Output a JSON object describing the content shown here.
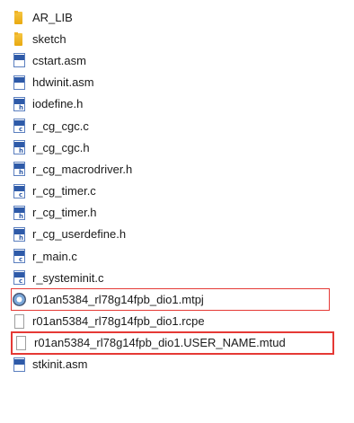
{
  "files": [
    {
      "name": "AR_LIB",
      "icon": "folder-icon"
    },
    {
      "name": "sketch",
      "icon": "folder-icon"
    },
    {
      "name": "cstart.asm",
      "icon": "asm-file-icon"
    },
    {
      "name": "hdwinit.asm",
      "icon": "asm-file-icon"
    },
    {
      "name": "iodefine.h",
      "icon": "header-file-icon"
    },
    {
      "name": "r_cg_cgc.c",
      "icon": "c-file-icon"
    },
    {
      "name": "r_cg_cgc.h",
      "icon": "header-file-icon"
    },
    {
      "name": "r_cg_macrodriver.h",
      "icon": "header-file-icon"
    },
    {
      "name": "r_cg_timer.c",
      "icon": "c-file-icon"
    },
    {
      "name": "r_cg_timer.h",
      "icon": "header-file-icon"
    },
    {
      "name": "r_cg_userdefine.h",
      "icon": "header-file-icon"
    },
    {
      "name": "r_main.c",
      "icon": "c-file-icon"
    },
    {
      "name": "r_systeminit.c",
      "icon": "c-file-icon"
    },
    {
      "name": "r01an5384_rl78g14fpb_dio1.mtpj",
      "icon": "project-file-icon"
    },
    {
      "name": "r01an5384_rl78g14fpb_dio1.rcpe",
      "icon": "blank-file-icon"
    },
    {
      "name": "r01an5384_rl78g14fpb_dio1.USER_NAME.mtud",
      "icon": "blank-file-icon"
    },
    {
      "name": "stkinit.asm",
      "icon": "asm-file-icon"
    }
  ],
  "highlight_color": "#e53935"
}
